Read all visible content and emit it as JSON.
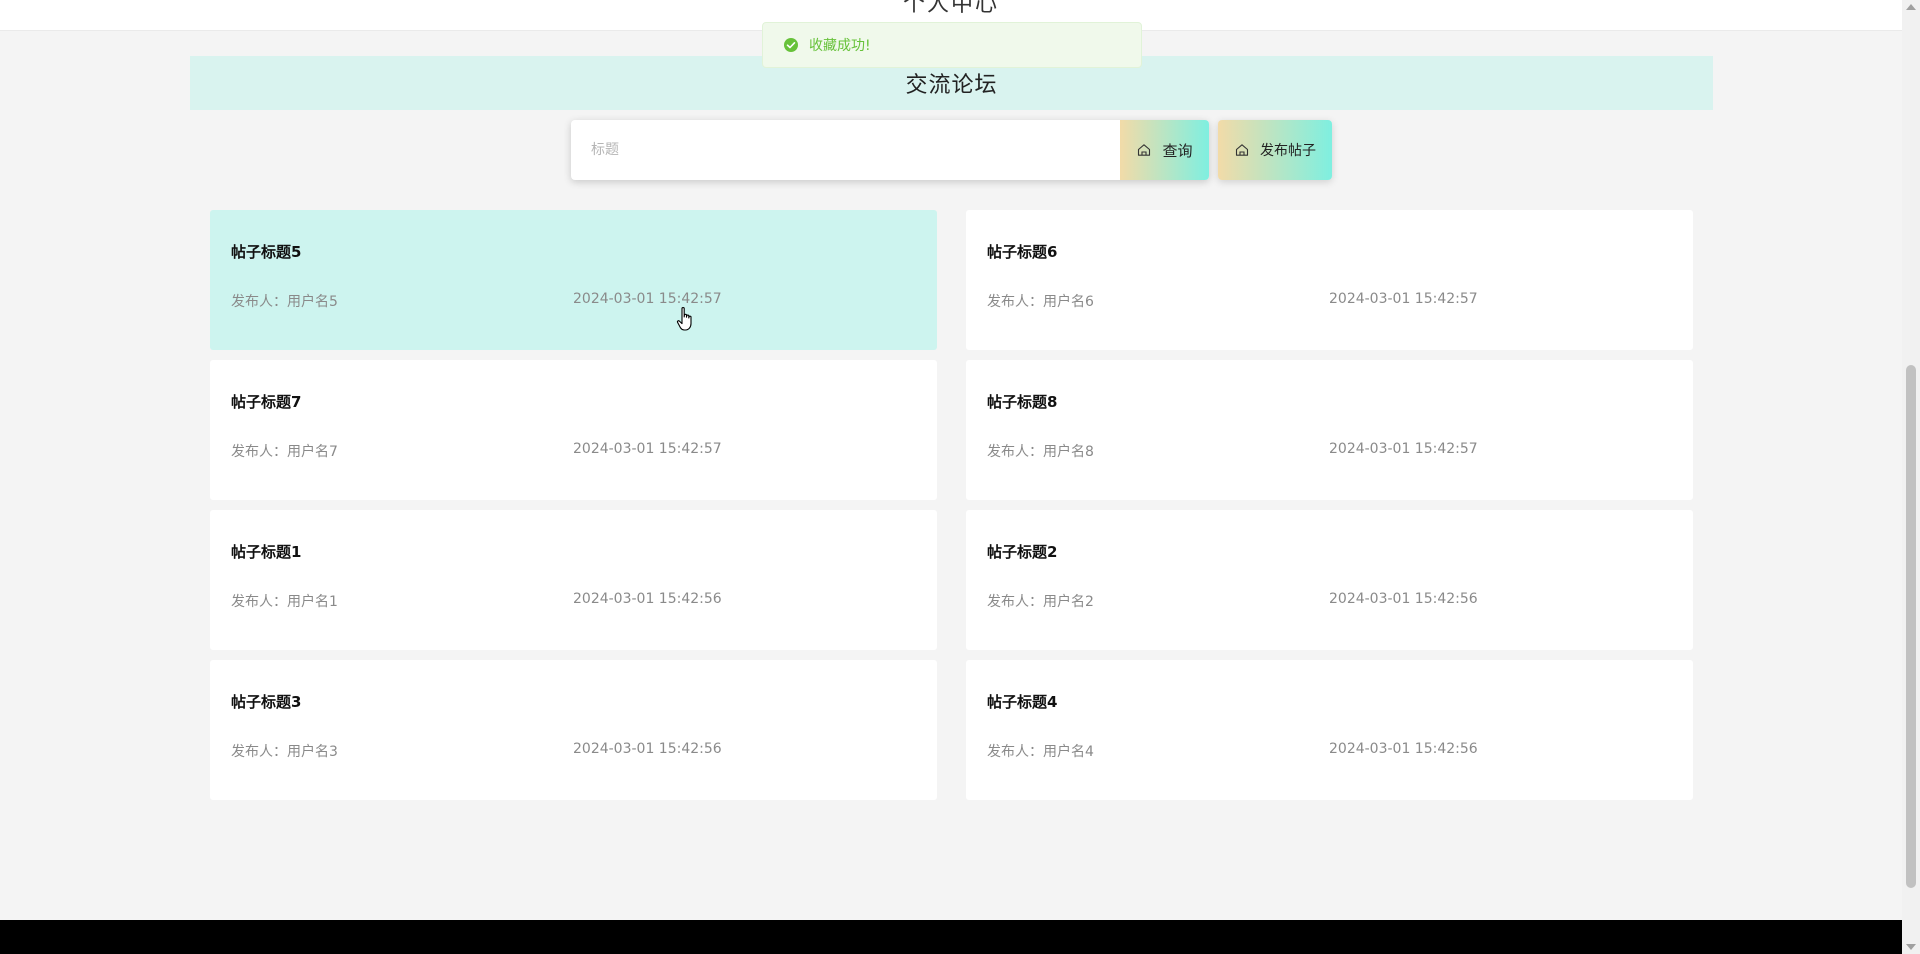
{
  "topbar": {
    "title": "个人中心"
  },
  "toast": {
    "message": "收藏成功!",
    "icon": "success-check-icon",
    "color": "#67c23a"
  },
  "section": {
    "title": "交流论坛"
  },
  "search": {
    "placeholder": "标题",
    "value": "",
    "query_label": "查询",
    "publish_label": "发布帖子"
  },
  "posts": [
    {
      "title": "帖子标题5",
      "author": "发布人：用户名5",
      "time": "2024-03-01 15:42:57",
      "hovered": true
    },
    {
      "title": "帖子标题6",
      "author": "发布人：用户名6",
      "time": "2024-03-01 15:42:57"
    },
    {
      "title": "帖子标题7",
      "author": "发布人：用户名7",
      "time": "2024-03-01 15:42:57"
    },
    {
      "title": "帖子标题8",
      "author": "发布人：用户名8",
      "time": "2024-03-01 15:42:57"
    },
    {
      "title": "帖子标题1",
      "author": "发布人：用户名1",
      "time": "2024-03-01 15:42:56"
    },
    {
      "title": "帖子标题2",
      "author": "发布人：用户名2",
      "time": "2024-03-01 15:42:56"
    },
    {
      "title": "帖子标题3",
      "author": "发布人：用户名3",
      "time": "2024-03-01 15:42:56"
    },
    {
      "title": "帖子标题4",
      "author": "发布人：用户名4",
      "time": "2024-03-01 15:42:56"
    }
  ],
  "colors": {
    "accent_gradient_start": "#f2dba8",
    "accent_gradient_end": "#7fefe0",
    "header_bg": "#d9f3ef",
    "hover_card_bg": "#cdf4ef"
  }
}
